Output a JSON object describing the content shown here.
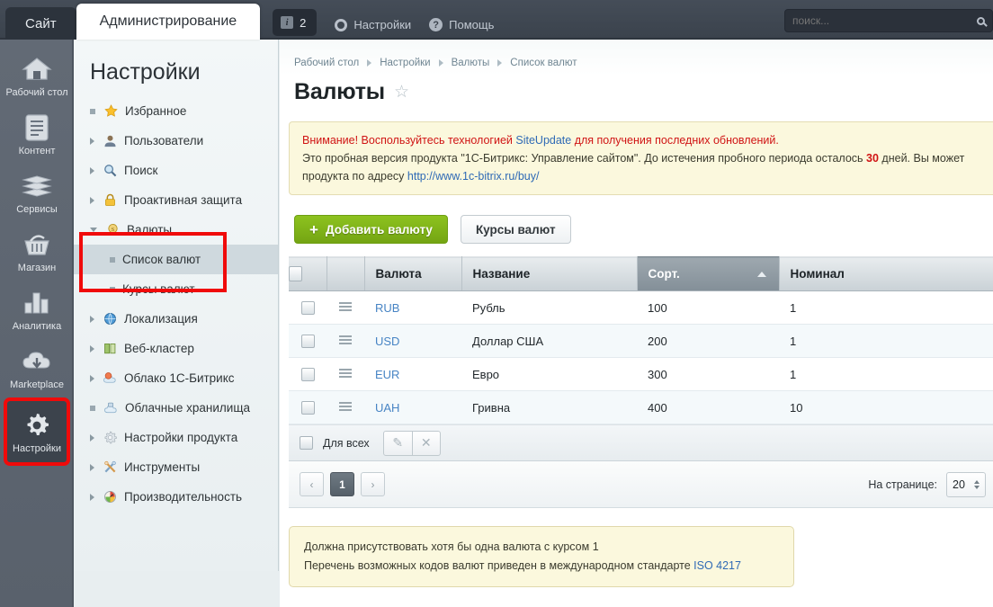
{
  "topbar": {
    "tab_site": "Сайт",
    "tab_admin": "Администрирование",
    "badge_count": "2",
    "settings_label": "Настройки",
    "help_label": "Помощь",
    "search_placeholder": "поиск...",
    "search_value": ""
  },
  "rail": {
    "items": [
      {
        "label": "Рабочий стол",
        "icon": "home-icon"
      },
      {
        "label": "Контент",
        "icon": "document-icon"
      },
      {
        "label": "Сервисы",
        "icon": "layers-icon"
      },
      {
        "label": "Магазин",
        "icon": "basket-icon"
      },
      {
        "label": "Аналитика",
        "icon": "bar-chart-icon"
      },
      {
        "label": "Marketplace",
        "icon": "cloud-download-icon"
      },
      {
        "label": "Настройки",
        "icon": "gear-icon"
      }
    ]
  },
  "menu": {
    "title": "Настройки",
    "items": [
      {
        "label": "Избранное",
        "marker": "dot",
        "icon": "star-icon",
        "level": 0,
        "selected": false
      },
      {
        "label": "Пользователи",
        "marker": "arrow",
        "icon": "user-icon",
        "level": 0,
        "selected": false
      },
      {
        "label": "Поиск",
        "marker": "arrow",
        "icon": "search-icon",
        "level": 0,
        "selected": false
      },
      {
        "label": "Проактивная защита",
        "marker": "arrow",
        "icon": "lock-icon",
        "level": 0,
        "selected": false
      },
      {
        "label": "Валюты",
        "marker": "arrow-down",
        "icon": "coin-icon",
        "level": 0,
        "selected": false
      },
      {
        "label": "Список валют",
        "marker": "dot",
        "icon": "none",
        "level": 1,
        "selected": true
      },
      {
        "label": "Курсы валют",
        "marker": "dot",
        "icon": "none",
        "level": 1,
        "selected": false
      },
      {
        "label": "Локализация",
        "marker": "arrow",
        "icon": "globe-icon",
        "level": 0,
        "selected": false
      },
      {
        "label": "Веб-кластер",
        "marker": "arrow",
        "icon": "servers-icon",
        "level": 0,
        "selected": false
      },
      {
        "label": "Облако 1С-Битрикс",
        "marker": "arrow",
        "icon": "cloud-bitrix-icon",
        "level": 0,
        "selected": false
      },
      {
        "label": "Облачные хранилища",
        "marker": "dot",
        "icon": "cloud-storage-icon",
        "level": 0,
        "selected": false
      },
      {
        "label": "Настройки продукта",
        "marker": "arrow",
        "icon": "gear-icon",
        "level": 0,
        "selected": false
      },
      {
        "label": "Инструменты",
        "marker": "arrow",
        "icon": "tools-icon",
        "level": 0,
        "selected": false
      },
      {
        "label": "Производительность",
        "marker": "arrow",
        "icon": "gauge-icon",
        "level": 0,
        "selected": false
      }
    ]
  },
  "breadcrumb": [
    "Рабочий стол",
    "Настройки",
    "Валюты",
    "Список валют"
  ],
  "page": {
    "title": "Валюты",
    "favorite_icon": "star-outline-icon"
  },
  "notice": {
    "warn_prefix": "Внимание! Воспользуйтесь технологией ",
    "link_text": "SiteUpdate",
    "warn_suffix": " для получения последних обновлений.",
    "line2_a": "Это пробная версия продукта \"1С-Битрикс: Управление сайтом\". До истечения пробного периода осталось ",
    "line2_days": "30",
    "line2_b": " дней. Вы может",
    "line3_a": "продукта по адресу ",
    "line3_link": "http://www.1c-bitrix.ru/buy/"
  },
  "toolbar": {
    "add_label": "Добавить валюту",
    "rates_label": "Курсы валют"
  },
  "table": {
    "columns": [
      "",
      "",
      "Валюта",
      "Название",
      "Сорт.",
      "Номинал"
    ],
    "sorted_column": "Сорт.",
    "sort_direction": "asc",
    "rows": [
      {
        "code": "RUB",
        "name": "Рубль",
        "sort": "100",
        "nominal": "1"
      },
      {
        "code": "USD",
        "name": "Доллар США",
        "sort": "200",
        "nominal": "1"
      },
      {
        "code": "EUR",
        "name": "Евро",
        "sort": "300",
        "nominal": "1"
      },
      {
        "code": "UAH",
        "name": "Гривна",
        "sort": "400",
        "nominal": "10"
      }
    ],
    "footer": {
      "select_all_label": "Для всех",
      "edit_icon": "pencil-icon",
      "delete_icon": "close-icon"
    }
  },
  "pagination": {
    "prev": "‹",
    "current": "1",
    "next": "›",
    "per_page_label": "На странице:",
    "per_page_value": "20"
  },
  "note": {
    "line1": "Должна присутствовать хотя бы одна валюта с курсом 1",
    "line2_a": "Перечень возможных кодов валют приведен в международном стандарте ",
    "line2_link": "ISO 4217"
  },
  "colors": {
    "accent_green": "#8dc21f",
    "link_blue": "#2f6ab5",
    "highlight_red": "#f00a0a",
    "topbar_dark": "#3e4650"
  }
}
